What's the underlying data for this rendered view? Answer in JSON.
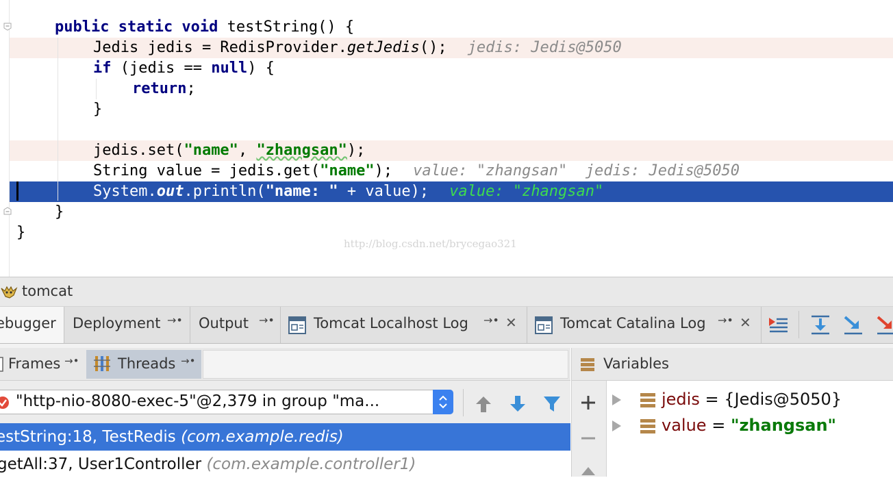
{
  "editor": {
    "lines": [
      {
        "indent": 1,
        "tokens": [
          {
            "t": "public static void",
            "c": "kw"
          },
          {
            "t": " testString() {",
            "c": ""
          }
        ]
      },
      {
        "indent": 2,
        "highlight": "breakpoint",
        "tokens": [
          {
            "t": "Jedis jedis = RedisProvider.",
            "c": ""
          },
          {
            "t": "getJedis",
            "c": "it"
          },
          {
            "t": "();",
            "c": ""
          }
        ],
        "inline": "jedis: Jedis@5050"
      },
      {
        "indent": 2,
        "tokens": [
          {
            "t": "if",
            "c": "kw"
          },
          {
            "t": " (jedis == ",
            "c": ""
          },
          {
            "t": "null",
            "c": "kw"
          },
          {
            "t": ") {",
            "c": ""
          }
        ]
      },
      {
        "indent": 3,
        "tokens": [
          {
            "t": "return",
            "c": "kw"
          },
          {
            "t": ";",
            "c": ""
          }
        ]
      },
      {
        "indent": 2,
        "tokens": [
          {
            "t": "}",
            "c": ""
          }
        ]
      },
      {
        "indent": 0,
        "tokens": []
      },
      {
        "indent": 2,
        "highlight": "breakpoint",
        "tokens": [
          {
            "t": "jedis.set(",
            "c": ""
          },
          {
            "t": "\"name\"",
            "c": "st"
          },
          {
            "t": ", ",
            "c": ""
          },
          {
            "t": "\"zhangsan\"",
            "c": "st squig"
          },
          {
            "t": ");",
            "c": ""
          }
        ]
      },
      {
        "indent": 2,
        "tokens": [
          {
            "t": "String value = jedis.get(",
            "c": ""
          },
          {
            "t": "\"name\"",
            "c": "st"
          },
          {
            "t": ");",
            "c": ""
          }
        ],
        "inline": "value: \"zhangsan\"  jedis: Jedis@5050"
      },
      {
        "indent": 2,
        "highlight": "current",
        "tokens": [
          {
            "t": "System.",
            "c": ""
          },
          {
            "t": "out",
            "c": "sf"
          },
          {
            "t": ".println(",
            "c": ""
          },
          {
            "t": "\"name: \"",
            "c": "st"
          },
          {
            "t": " + value);",
            "c": ""
          }
        ],
        "inline": "value: \"zhangsan\""
      },
      {
        "indent": 1,
        "tokens": [
          {
            "t": "}",
            "c": ""
          }
        ]
      },
      {
        "indent": 0,
        "tokens": [
          {
            "t": "}",
            "c": ""
          }
        ]
      }
    ],
    "watermark": "http://blog.csdn.net/brycegao321"
  },
  "tool_window": {
    "title": "tomcat",
    "tabs": [
      {
        "label": "ebugger",
        "active": true
      },
      {
        "label": "Deployment",
        "pin": "→•"
      },
      {
        "label": "Output",
        "pin": "→•"
      },
      {
        "label": "Tomcat Localhost Log",
        "pin": "→•",
        "close": "✕"
      },
      {
        "label": "Tomcat Catalina Log",
        "pin": "→•",
        "close": "✕"
      }
    ],
    "toolbar_icons": [
      "show-execution-point-icon",
      "step-over-icon",
      "step-into-icon",
      "force-step-into-icon"
    ]
  },
  "frames": {
    "subtabs": [
      {
        "label": "Frames",
        "pin": "→•"
      },
      {
        "label": "Threads",
        "pin": "→•"
      }
    ],
    "thread_selector": "\"http-nio-8080-exec-5\"@2,379 in group \"ma...",
    "items": [
      {
        "method": "estString:18, TestRedis",
        "package": "(com.example.redis)",
        "selected": true
      },
      {
        "method": "getAll:37, User1Controller",
        "package": "(com.example.controller1)",
        "selected": false
      }
    ]
  },
  "variables": {
    "title": "Variables",
    "items": [
      {
        "name": "jedis",
        "eq": " = ",
        "value": "{Jedis@5050}",
        "string": false
      },
      {
        "name": "value",
        "eq": " = ",
        "value": "\"zhangsan\"",
        "string": true
      }
    ]
  },
  "colors": {
    "current_line": "#2653ae",
    "breakpoint_line": "#faeeea",
    "selected_frame": "#3875d7",
    "keyword": "#000080",
    "string": "#007a00",
    "inline_value_current": "#3edc4e"
  }
}
